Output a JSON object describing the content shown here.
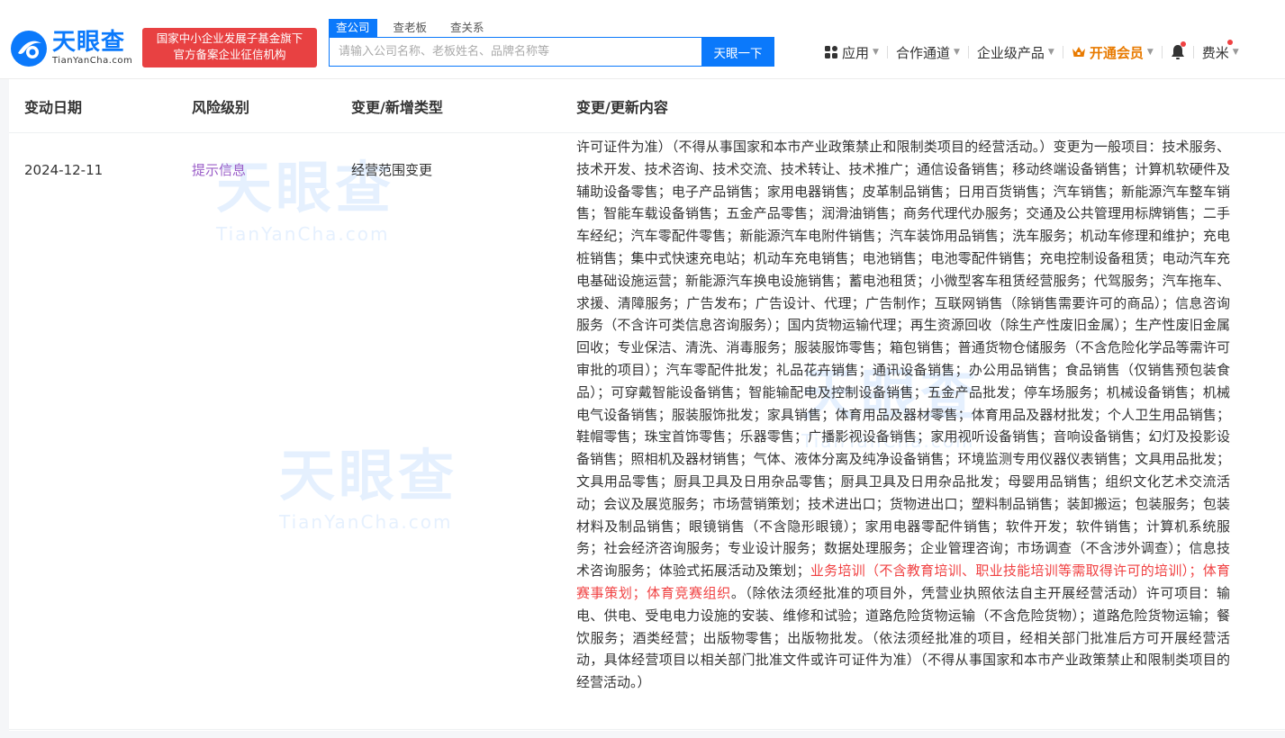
{
  "header": {
    "logo_text": "天眼查",
    "logo_sub": "TianYanCha.com",
    "badge_line1": "国家中小企业发展子基金旗下",
    "badge_line2": "官方备案企业征信机构",
    "search_tabs": [
      "查公司",
      "查老板",
      "查关系"
    ],
    "search_placeholder": "请输入公司名称、老板姓名、品牌名称等",
    "search_button": "天眼一下",
    "nav": {
      "apps": "应用",
      "partner": "合作通道",
      "enterprise": "企业级产品",
      "vip": "开通会员",
      "user": "费米"
    }
  },
  "table": {
    "headers": [
      "变动日期",
      "风险级别",
      "变更/新增类型",
      "变更/更新内容"
    ],
    "row": {
      "date": "2024-12-11",
      "risk": "提示信息",
      "type": "经营范围变更",
      "content_before": "许可证件为准）（不得从事国家和本市产业政策禁止和限制类项目的经营活动。）变更为一般项目：技术服务、技术开发、技术咨询、技术交流、技术转让、技术推广；通信设备销售；移动终端设备销售；计算机软硬件及辅助设备零售；电子产品销售；家用电器销售；皮革制品销售；日用百货销售；汽车销售；新能源汽车整车销售；智能车载设备销售；五金产品零售；润滑油销售；商务代理代办服务；交通及公共管理用标牌销售；二手车经纪；汽车零配件零售；新能源汽车电附件销售；汽车装饰用品销售；洗车服务；机动车修理和维护；充电桩销售；集中式快速充电站；机动车充电销售；电池销售；电池零配件销售；充电控制设备租赁；电动汽车充电基础设施运营；新能源汽车换电设施销售；蓄电池租赁；小微型客车租赁经营服务；代驾服务；汽车拖车、求援、清障服务；广告发布；广告设计、代理；广告制作；互联网销售（除销售需要许可的商品）；信息咨询服务（不含许可类信息咨询服务）；国内货物运输代理；再生资源回收（除生产性废旧金属）；生产性废旧金属回收；专业保洁、清洗、消毒服务；服装服饰零售；箱包销售；普通货物仓储服务（不含危险化学品等需许可审批的项目）；汽车零配件批发；礼品花卉销售；通讯设备销售；办公用品销售；食品销售（仅销售预包装食品）；可穿戴智能设备销售；智能输配电及控制设备销售；五金产品批发；停车场服务；机械设备销售；机械电气设备销售；服装服饰批发；家具销售；体育用品及器材零售；体育用品及器材批发；个人卫生用品销售；鞋帽零售；珠宝首饰零售；乐器零售；广播影视设备销售；家用视听设备销售；音响设备销售；幻灯及投影设备销售；照相机及器材销售；气体、液体分离及纯净设备销售；环境监测专用仪器仪表销售；文具用品批发；文具用品零售；厨具卫具及日用杂品零售；厨具卫具及日用杂品批发；母婴用品销售；组织文化艺术交流活动；会议及展览服务；市场营销策划；技术进出口；货物进出口；塑料制品销售；装卸搬运；包装服务；包装材料及制品销售；眼镜销售（不含隐形眼镜）；家用电器零配件销售；软件开发；软件销售；计算机系统服务；社会经济咨询服务；专业设计服务；数据处理服务；企业管理咨询；市场调查（不含涉外调查）；信息技术咨询服务；体验式拓展活动及策划；",
      "content_highlight": "业务培训（不含教育培训、职业技能培训等需取得许可的培训）；体育赛事策划；体育竞赛组织",
      "content_after": "。（除依法须经批准的项目外，凭营业执照依法自主开展经营活动）许可项目：输电、供电、受电电力设施的安装、维修和试验；道路危险货物运输（不含危险货物）；道路危险货物运输；餐饮服务；酒类经营；出版物零售；出版物批发。（依法须经批准的项目，经相关部门批准后方可开展经营活动，具体经营项目以相关部门批准文件或许可证件为准）（不得从事国家和本市产业政策禁止和限制类项目的经营活动。）"
    }
  },
  "colors": {
    "brand": "#0b79fb",
    "badge": "#e84142",
    "risk": "#9b5ec8",
    "highlight": "#f04142",
    "vip": "#e87a00"
  }
}
